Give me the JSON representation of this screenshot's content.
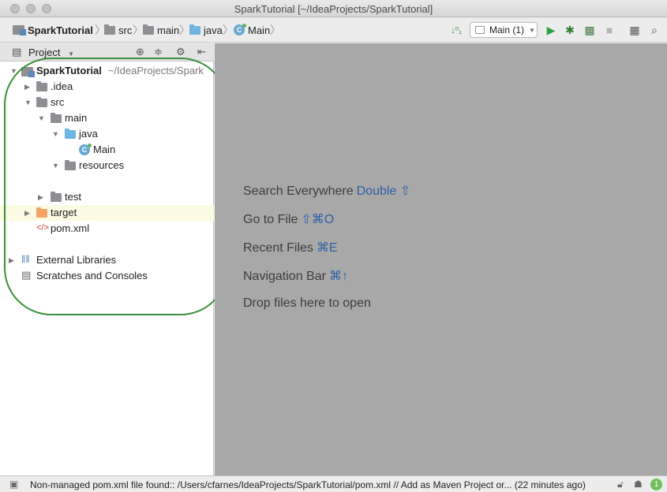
{
  "window": {
    "title": "SparkTutorial [~/IdeaProjects/SparkTutorial]"
  },
  "breadcrumbs": [
    {
      "label": "SparkTutorial",
      "icon": "project-icon"
    },
    {
      "label": "src",
      "icon": "folder-icon"
    },
    {
      "label": "main",
      "icon": "folder-icon"
    },
    {
      "label": "java",
      "icon": "source-folder-icon"
    },
    {
      "label": "Main",
      "icon": "java-class-icon"
    }
  ],
  "toolbar": {
    "run_config": "Main (1)",
    "icons": [
      "sort-icon",
      "run-icon",
      "debug-icon",
      "coverage-icon",
      "stop-icon",
      "project-structure-icon",
      "search-icon"
    ]
  },
  "project_panel": {
    "title": "Project",
    "tree": [
      {
        "label": "SparkTutorial",
        "hint": "~/IdeaProjects/Spark",
        "bold": true
      },
      {
        "label": ".idea"
      },
      {
        "label": "src"
      },
      {
        "label": "main"
      },
      {
        "label": "java"
      },
      {
        "label": "Main"
      },
      {
        "label": "resources"
      },
      {
        "label": "test"
      },
      {
        "label": "target"
      },
      {
        "label": "pom.xml"
      },
      {
        "label": "External Libraries"
      },
      {
        "label": "Scratches and Consoles"
      }
    ]
  },
  "editor_hints": [
    {
      "text": "Search Everywhere",
      "shortcut": "Double ⇧"
    },
    {
      "text": "Go to File",
      "shortcut": "⇧⌘O"
    },
    {
      "text": "Recent Files",
      "shortcut": "⌘E"
    },
    {
      "text": "Navigation Bar",
      "shortcut": "⌘↑"
    },
    {
      "text": "Drop files here to open",
      "shortcut": ""
    }
  ],
  "status_bar": {
    "message": "Non-managed pom.xml file found:: /Users/cfarnes/IdeaProjects/SparkTutorial/pom.xml // Add as Maven Project or... (22 minutes ago)",
    "notification_count": "1"
  },
  "colors": {
    "annotation": "#3a8f3a",
    "editor_bg": "#a8a8a8",
    "shortcut": "#2f5fa8"
  }
}
